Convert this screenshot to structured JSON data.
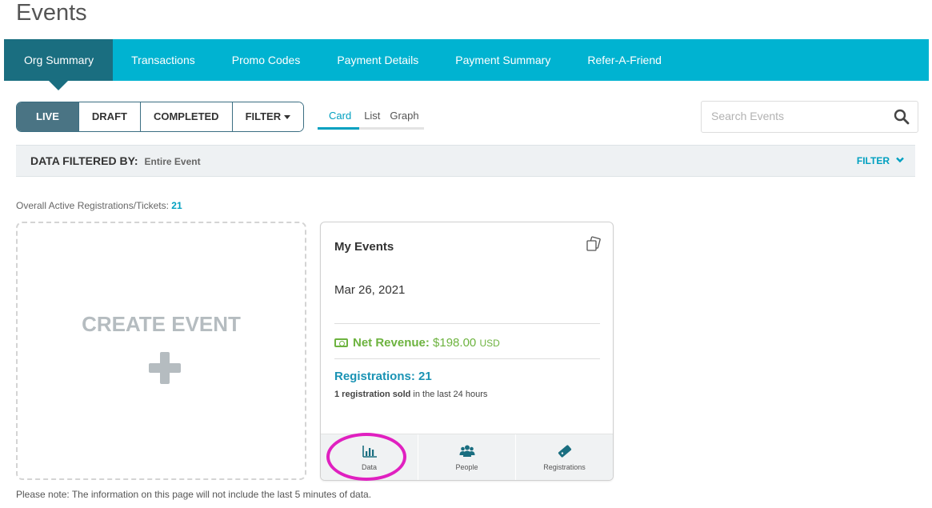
{
  "page": {
    "title": "Events"
  },
  "nav": {
    "items": [
      {
        "label": "Org Summary",
        "active": true
      },
      {
        "label": "Transactions"
      },
      {
        "label": "Promo Codes"
      },
      {
        "label": "Payment Details"
      },
      {
        "label": "Payment Summary"
      },
      {
        "label": "Refer-A-Friend"
      }
    ]
  },
  "status_filter": {
    "buttons": [
      "LIVE",
      "DRAFT",
      "COMPLETED",
      "FILTER"
    ],
    "active": "LIVE"
  },
  "views": {
    "tabs": [
      "Card",
      "List",
      "Graph"
    ],
    "active": "Card"
  },
  "search": {
    "placeholder": "Search Events",
    "value": ""
  },
  "data_filter": {
    "label": "DATA FILTERED BY:",
    "value": "Entire Event",
    "toggle": "FILTER"
  },
  "summary": {
    "label": "Overall Active Registrations/Tickets:",
    "count": "21"
  },
  "create_event": {
    "label": "CREATE EVENT"
  },
  "event_card": {
    "title": "My Events",
    "date": "Mar 26, 2021",
    "net_revenue_label": "Net Revenue:",
    "net_revenue_value": "$198.00",
    "currency": "USD",
    "registrations_label": "Registrations: 21",
    "sold_bold": "1 registration sold",
    "sold_rest": "in the last 24 hours",
    "actions": [
      {
        "label": "Data",
        "icon": "bar-chart-icon"
      },
      {
        "label": "People",
        "icon": "people-icon"
      },
      {
        "label": "Registrations",
        "icon": "ticket-icon"
      }
    ]
  },
  "note": "Please note: The information on this page will not include the last 5 minutes of data.",
  "colors": {
    "nav_bg": "#00b3d1",
    "nav_active": "#1a6e80",
    "accent": "#00a0c0",
    "revenue": "#6db33f",
    "highlight": "#e020c0"
  }
}
